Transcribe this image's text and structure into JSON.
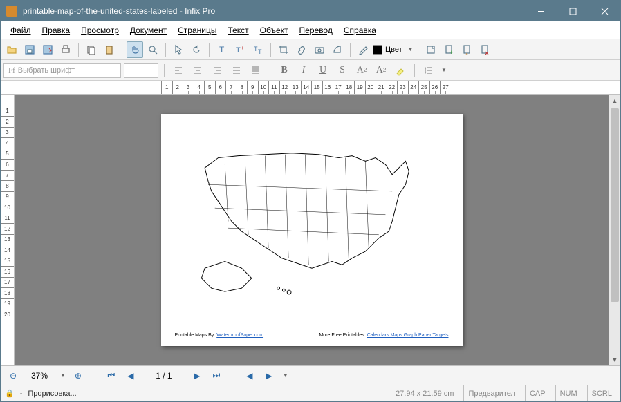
{
  "window": {
    "title": "printable-map-of-the-united-states-labeled - Infix Pro"
  },
  "menu": {
    "file": "Файл",
    "edit": "Правка",
    "view": "Просмотр",
    "document": "Документ",
    "pages": "Страницы",
    "text": "Текст",
    "object": "Объект",
    "translate": "Перевод",
    "help": "Справка"
  },
  "toolbar": {
    "color_label": "Цвет"
  },
  "font": {
    "placeholder": "Выбрать шрифт"
  },
  "nav": {
    "zoom": "37%",
    "page": "1 / 1"
  },
  "status": {
    "rendering": "Прорисовка...",
    "dimensions": "27.94 x 21.59 cm",
    "preview": "Предварител",
    "cap": "CAP",
    "num": "NUM",
    "scrl": "SCRL"
  },
  "document": {
    "footer_left_label": "Printable Maps By:",
    "footer_left_link": "WaterproofPaper.com",
    "footer_right_label": "More Free Printables:",
    "footer_right_links": "Calendars   Maps   Graph Paper   Targets"
  },
  "ruler_h": [
    "1",
    "2",
    "3",
    "4",
    "5",
    "6",
    "7",
    "8",
    "9",
    "10",
    "11",
    "12",
    "13",
    "14",
    "15",
    "16",
    "17",
    "18",
    "19",
    "20",
    "21",
    "22",
    "23",
    "24",
    "25",
    "26",
    "27"
  ],
  "ruler_v": [
    "",
    "1",
    "2",
    "3",
    "4",
    "5",
    "6",
    "7",
    "8",
    "9",
    "10",
    "11",
    "12",
    "13",
    "14",
    "15",
    "16",
    "17",
    "18",
    "19",
    "20"
  ]
}
